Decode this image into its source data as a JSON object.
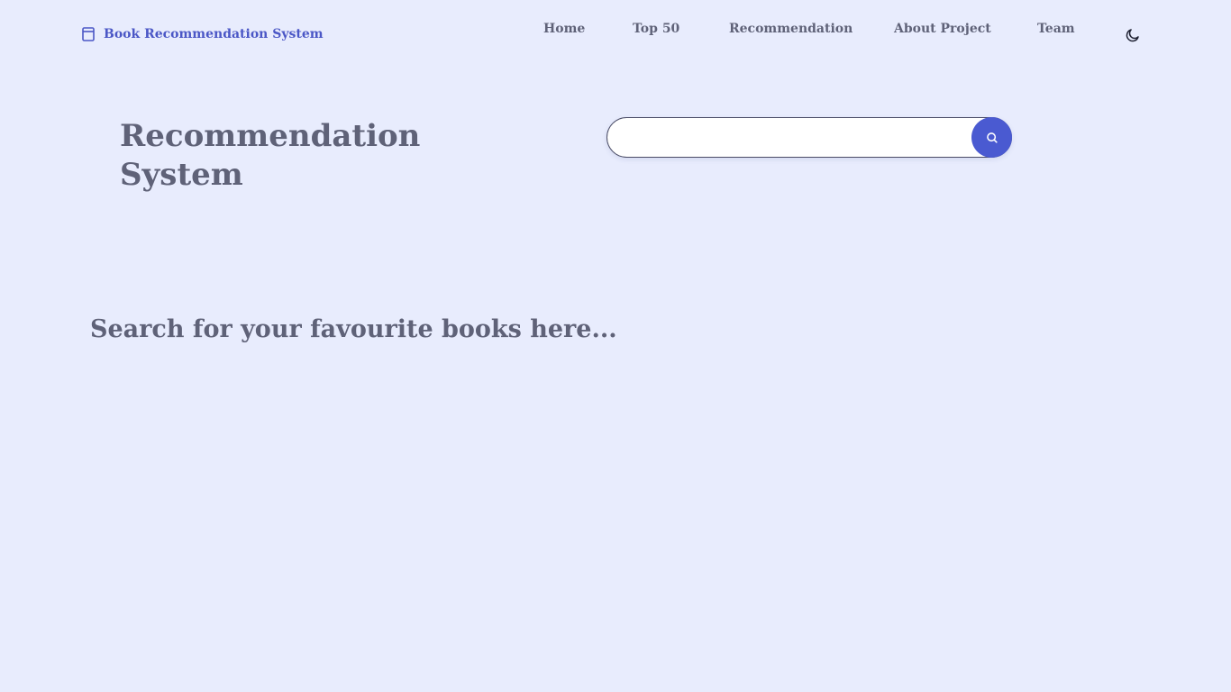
{
  "brand": {
    "name": "Book Recommendation System",
    "icon": "book-icon",
    "color": "#4b57c6"
  },
  "nav": {
    "items": [
      {
        "label": "Home"
      },
      {
        "label": "Top 50"
      },
      {
        "label": "Recommendation"
      },
      {
        "label": "About Project"
      },
      {
        "label": "Team"
      }
    ],
    "theme_toggle_icon": "moon-icon"
  },
  "hero": {
    "title": "Recommendation System"
  },
  "search": {
    "value": "",
    "placeholder": "",
    "button_icon": "search-icon",
    "button_color": "#4a5ad1"
  },
  "prompt": {
    "text": "Search for your favourite books here..."
  },
  "colors": {
    "background": "#e8ecfd",
    "text": "#5f6278"
  }
}
